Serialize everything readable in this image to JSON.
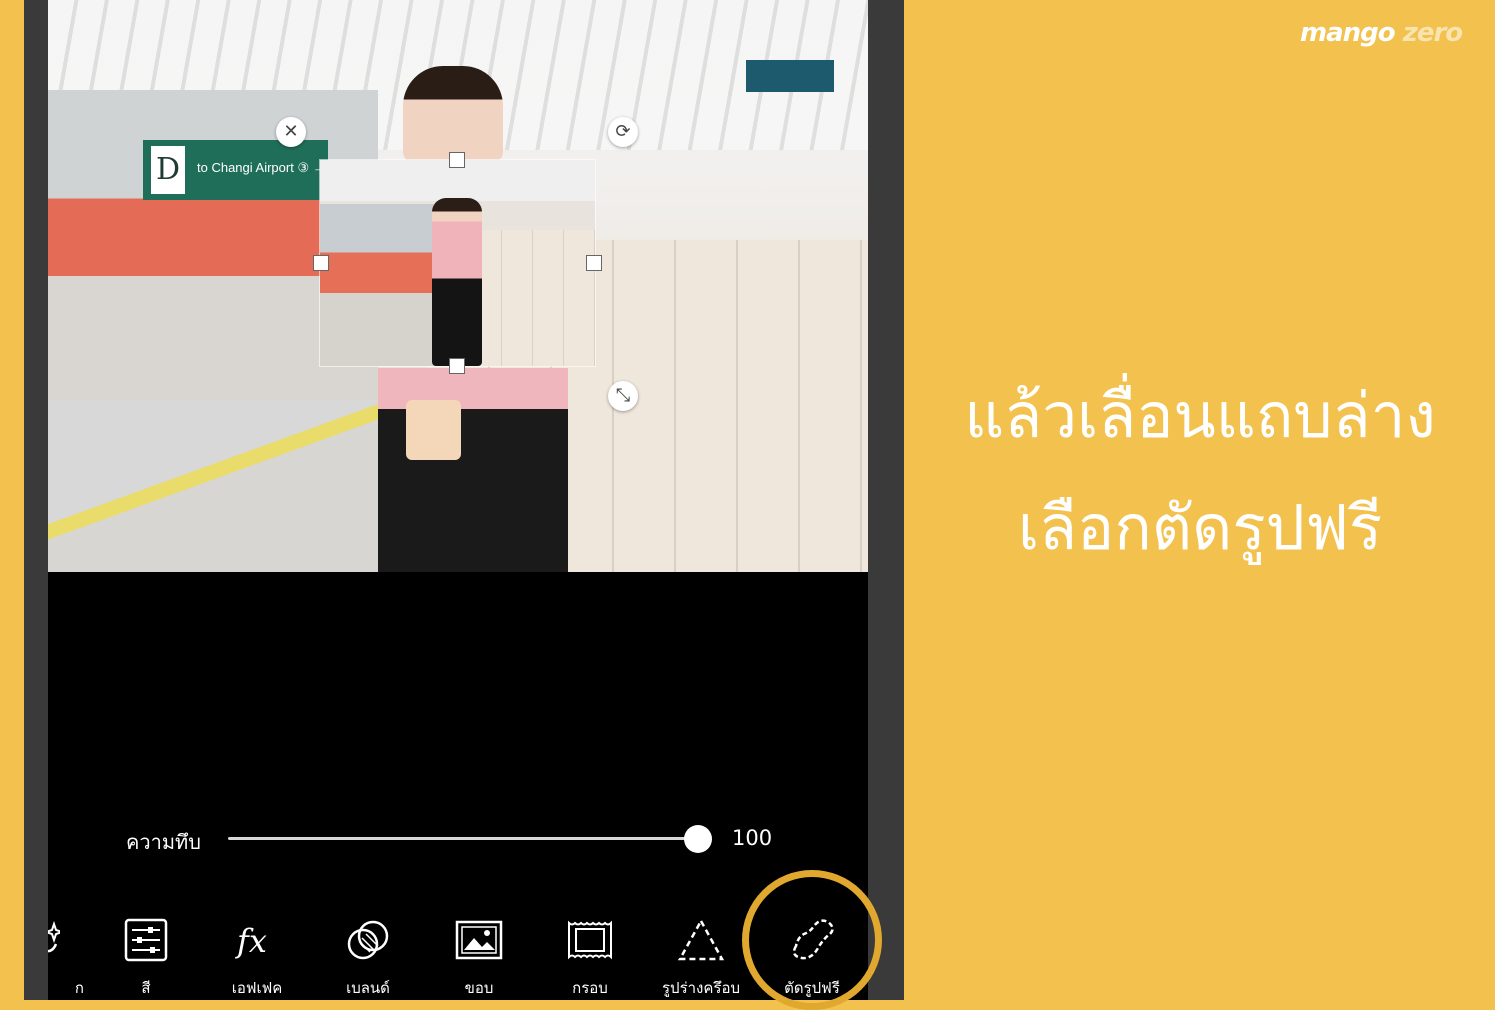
{
  "brand": {
    "name_part1": "mango",
    "name_part2": "zero"
  },
  "caption": {
    "line1": "แล้วเลื่อนแถบล่าง",
    "line2": "เลือกตัดรูปฟรี"
  },
  "photo": {
    "sign_letter": "D",
    "sign_text": "to Changi Airport ③ →"
  },
  "opacity": {
    "label": "ความทึบ",
    "value": "100",
    "level_percent": 100
  },
  "toolbar": {
    "partial_label": "ก",
    "tools": [
      {
        "label": "สี",
        "icon": "adjust-icon"
      },
      {
        "label": "เอฟเฟค",
        "icon": "fx-icon"
      },
      {
        "label": "เบลนด์",
        "icon": "blend-icon"
      },
      {
        "label": "ขอบ",
        "icon": "border-icon"
      },
      {
        "label": "กรอบ",
        "icon": "frame-icon"
      },
      {
        "label": "รูปร่างครึอบ",
        "icon": "shape-crop-icon"
      },
      {
        "label": "ตัดรูปฟรี",
        "icon": "free-crop-icon"
      }
    ]
  },
  "colors": {
    "background": "#f2c14e",
    "highlight": "#e0a82f",
    "screen": "#000000"
  }
}
